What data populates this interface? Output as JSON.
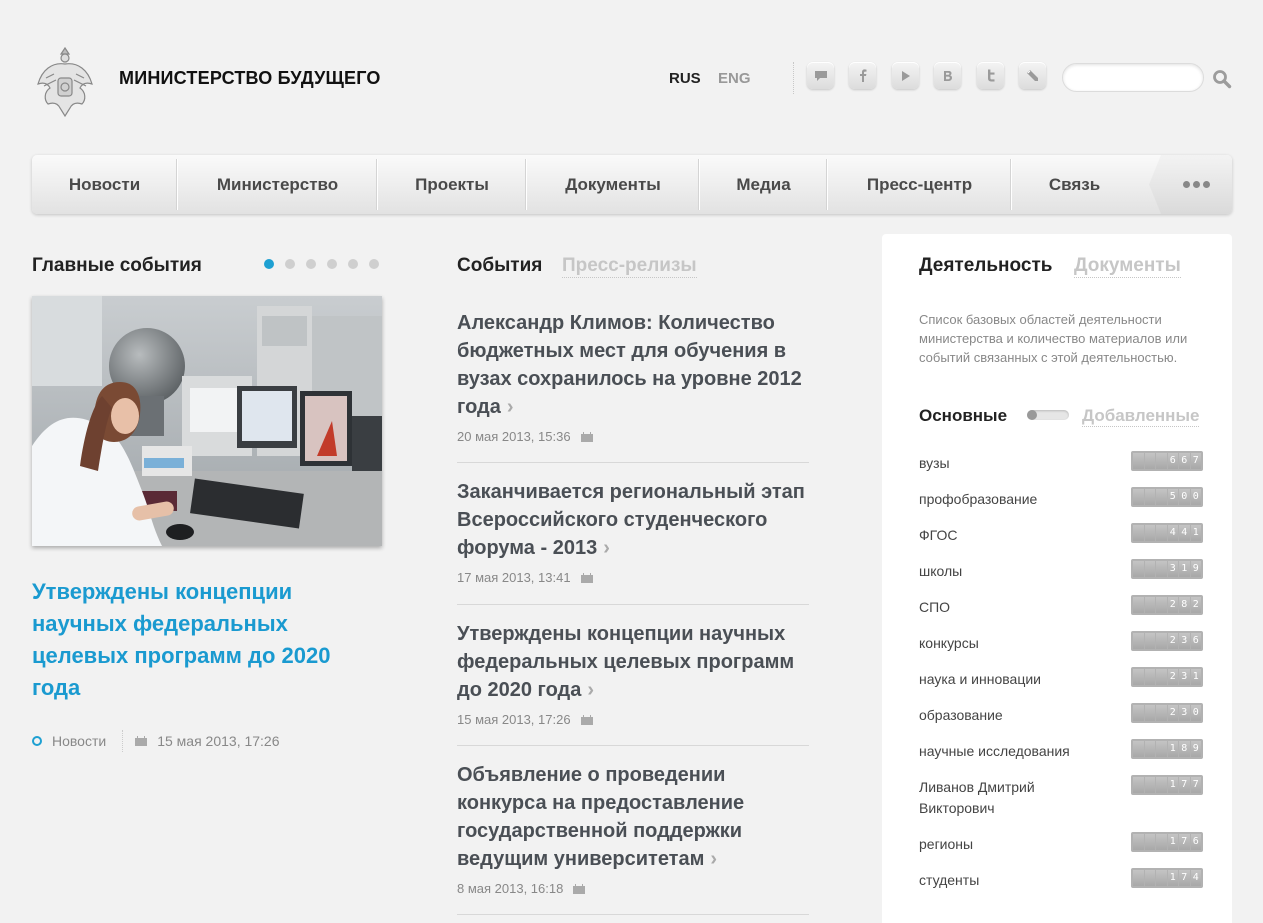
{
  "header": {
    "site_title": "МИНИСТЕРСТВО БУДУЩЕГО",
    "lang_rus": "RUS",
    "lang_eng": "ENG",
    "social_icons": [
      "chat-icon",
      "facebook-icon",
      "youtube-icon",
      "vkontakte-icon",
      "twitter-icon",
      "livejournal-icon"
    ],
    "search_placeholder": ""
  },
  "nav": {
    "items": [
      "Новости",
      "Министерство",
      "Проекты",
      "Документы",
      "Медиа",
      "Пресс-центр",
      "Связь"
    ]
  },
  "main_events": {
    "title": "Главные события",
    "slides_count": 6,
    "active_slide": 1,
    "headline": "Утверждены концепции научных федеральных целевых программ до 2020 года",
    "category": "Новости",
    "date": "15 мая 2013, 17:26"
  },
  "events": {
    "tab_active": "События",
    "tab_inactive": "Пресс-релизы",
    "items": [
      {
        "title": "Александр Климов: Количество бюджетных мест для обучения в вузах сохранилось на уровне 2012 года",
        "date": "20 мая 2013, 15:36"
      },
      {
        "title": "Заканчивается региональный этап Всероссийского студенческого форума - 2013",
        "date": "17 мая 2013, 13:41"
      },
      {
        "title": "Утверждены концепции научных федеральных целевых программ до 2020 года",
        "date": "15 мая 2013, 17:26"
      },
      {
        "title": "Объявление о проведении конкурса на предоставление государственной поддержки ведущим университетам",
        "date": "8 мая 2013, 16:18"
      }
    ]
  },
  "activity": {
    "tab_active": "Деятельность",
    "tab_inactive": "Документы",
    "description": "Список базовых областей деятельности министерства и количество материалов или событий связанных с этой деятельностью.",
    "toggle_left": "Основные",
    "toggle_right": "Добавленные",
    "categories": [
      {
        "label": "вузы",
        "count": "667"
      },
      {
        "label": "профобразование",
        "count": "500"
      },
      {
        "label": "ФГОС",
        "count": "441"
      },
      {
        "label": "школы",
        "count": "319"
      },
      {
        "label": "СПО",
        "count": "282"
      },
      {
        "label": "конкурсы",
        "count": "236"
      },
      {
        "label": "наука и инновации",
        "count": "231"
      },
      {
        "label": "образование",
        "count": "230"
      },
      {
        "label": "научные исследования",
        "count": "189"
      },
      {
        "label": "Ливанов Дмитрий Викторович",
        "count": "177"
      },
      {
        "label": "регионы",
        "count": "176"
      },
      {
        "label": "студенты",
        "count": "174"
      }
    ]
  },
  "colors": {
    "accent": "#1a9ad0",
    "background": "#f2f2f2",
    "news_title": "#4a4f55",
    "muted": "#c6c6c6"
  }
}
